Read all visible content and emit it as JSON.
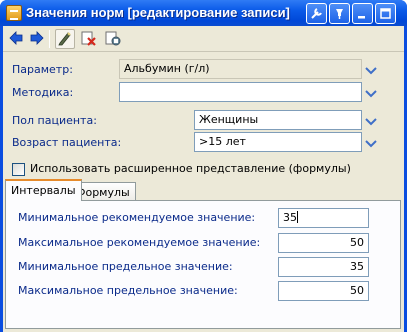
{
  "window": {
    "title": "Значения норм [редактирование записи]"
  },
  "form": {
    "parameter": {
      "label": "Параметр:",
      "value": "Альбумин (г/л)"
    },
    "method": {
      "label": "Методика:",
      "value": ""
    },
    "patient_sex": {
      "label": "Пол пациента:",
      "value": "Женщины"
    },
    "patient_age": {
      "label": "Возраст пациента:",
      "value": ">15 лет"
    },
    "extended_checkbox": {
      "label": "Использовать расширенное представление (формулы)",
      "checked": false
    }
  },
  "tabs": [
    {
      "label": "Интервалы",
      "active": true
    },
    {
      "label": "Формулы",
      "active": false
    }
  ],
  "intervals": [
    {
      "label": "Минимальное рекомендуемое значение:",
      "value": "35"
    },
    {
      "label": "Максимальное рекомендуемое значение:",
      "value": "50"
    },
    {
      "label": "Минимальное предельное значение:",
      "value": "35"
    },
    {
      "label": "Максимальное предельное значение:",
      "value": "50"
    }
  ],
  "colors": {
    "titlebar": "#0a5ae8",
    "label_text": "#0a2a8a",
    "background": "#ece9d8",
    "active_tab_accent": "#e68b2c"
  },
  "icons": {
    "title": "app-icon",
    "toolbar": [
      "back-arrow-icon",
      "forward-arrow-icon",
      "edit-pen-icon",
      "delete-record-icon",
      "save-record-icon"
    ],
    "caption": [
      "tools-icon",
      "pin-icon",
      "minimize-icon",
      "maximize-icon",
      "close-icon"
    ]
  }
}
